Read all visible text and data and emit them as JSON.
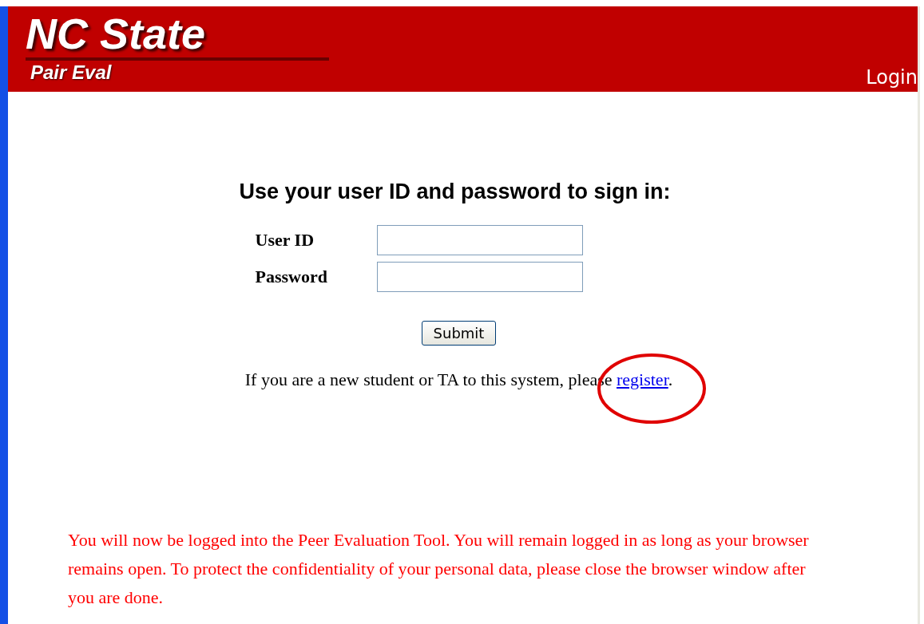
{
  "header": {
    "logo_title": "NC State",
    "logo_subtitle": "Pair Eval",
    "page_title": "Login"
  },
  "heading": "Use your user ID and password to sign in:",
  "fields": [
    {
      "label": "User ID"
    },
    {
      "label": "Password"
    }
  ],
  "submit_button": "Submit",
  "register_text": {
    "before": "If you are a new student or TA to this system, please",
    "link": "register",
    "after": ".",
    "circled": true
  },
  "notice": "You will now be logged into the Peer Evaluation Tool. You will remain logged in as long as your browser remains open. To protect the confidentiality of your personal data, please close the browser window after you are done."
}
